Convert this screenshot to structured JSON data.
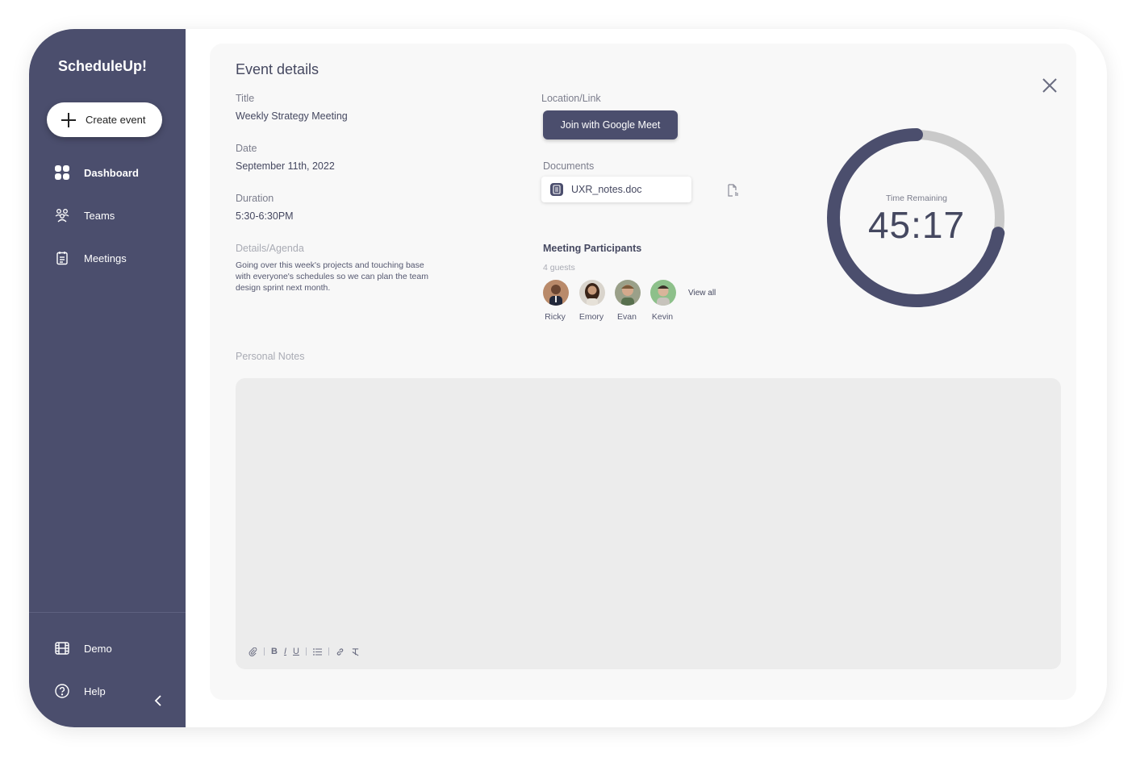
{
  "app": {
    "name": "ScheduleUp!"
  },
  "sidebar": {
    "create_label": "Create event",
    "items": [
      {
        "label": "Dashboard",
        "icon": "grid-icon",
        "active": true
      },
      {
        "label": "Teams",
        "icon": "users-icon"
      },
      {
        "label": "Meetings",
        "icon": "calendar-note-icon"
      }
    ],
    "bottom": [
      {
        "label": "Demo",
        "icon": "film-icon"
      },
      {
        "label": "Help",
        "icon": "help-circle-icon"
      }
    ],
    "collapse_icon": "chevron-left-icon"
  },
  "event": {
    "heading": "Event details",
    "title_label": "Title",
    "title_value": "Weekly Strategy Meeting",
    "date_label": "Date",
    "date_value": "September 11th, 2022",
    "duration_label": "Duration",
    "duration_value": "5:30-6:30PM",
    "details_label": "Details/Agenda",
    "details_value": "Going over this week's projects and touching base with everyone's schedules so we can plan the team design sprint next month.",
    "location_label": "Location/Link",
    "meet_button": "Join with Google Meet",
    "documents_label": "Documents",
    "document_name": "UXR_notes.doc",
    "participants_label": "Meeting Participants",
    "guests_count": "4 guests",
    "participants": [
      "Ricky",
      "Emory",
      "Evan",
      "Kevin"
    ],
    "view_all": "View all"
  },
  "timer": {
    "label": "Time Remaining",
    "value": "45:17",
    "fraction_remaining": 0.72,
    "colors": {
      "fill": "#4b4e6d",
      "track": "#c9c9c9"
    }
  },
  "notes": {
    "label": "Personal Notes",
    "placeholder": ""
  },
  "colors": {
    "sidebar": "#4b4e6d",
    "panel": "#f8f8f8",
    "notes_bg": "#ececec"
  }
}
